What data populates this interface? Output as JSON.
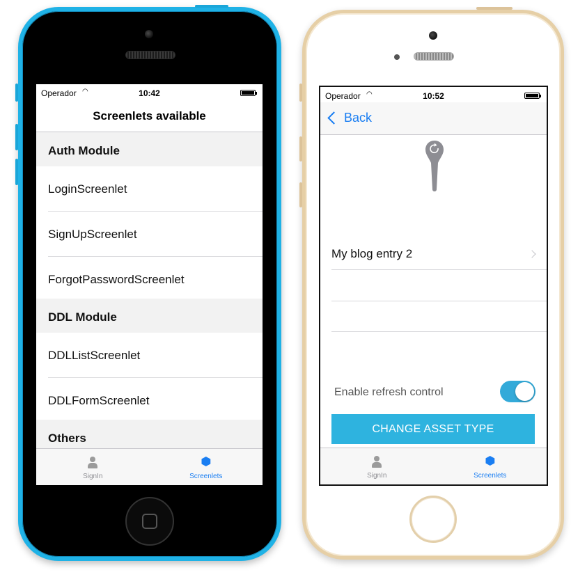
{
  "left_phone": {
    "status": {
      "carrier": "Operador",
      "time": "10:42"
    },
    "nav_title": "Screenlets available",
    "sections": [
      {
        "header": "Auth Module",
        "rows": [
          "LoginScreenlet",
          "SignUpScreenlet",
          "ForgotPasswordScreenlet"
        ]
      },
      {
        "header": "DDL Module",
        "rows": [
          "DDLListScreenlet",
          "DDLFormScreenlet"
        ]
      },
      {
        "header": "Others",
        "rows": []
      }
    ],
    "tabs": [
      {
        "label": "SignIn",
        "icon": "person-icon",
        "active": false
      },
      {
        "label": "Screenlets",
        "icon": "hexagon-icon",
        "active": true
      }
    ]
  },
  "right_phone": {
    "status": {
      "carrier": "Operador",
      "time": "10:52"
    },
    "back_label": "Back",
    "asset_row": "My blog entry 2",
    "refresh_label": "Enable refresh control",
    "refresh_enabled": true,
    "change_button": "CHANGE ASSET TYPE",
    "tabs": [
      {
        "label": "SignIn",
        "icon": "person-icon",
        "active": false
      },
      {
        "label": "Screenlets",
        "icon": "hexagon-icon",
        "active": true
      }
    ]
  },
  "colors": {
    "accent_blue": "#1a7ef2",
    "button_blue": "#2eb3df",
    "toggle_on": "#33aad9",
    "phone_blue": "#1fb2e6",
    "phone_gold": "#e6cfa6"
  }
}
